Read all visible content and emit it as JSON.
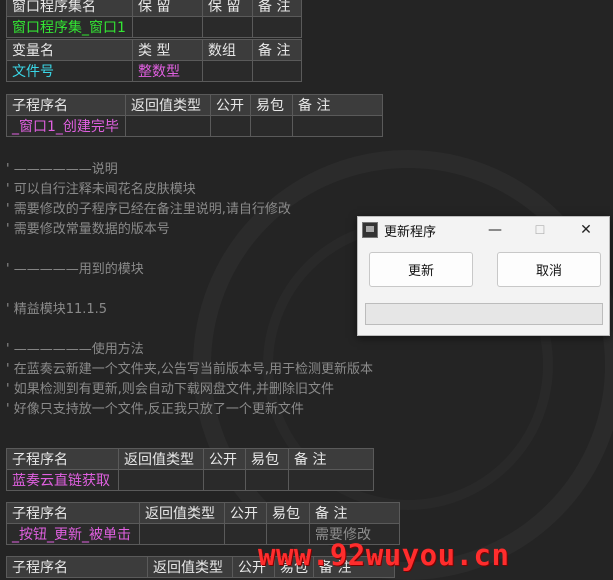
{
  "window_table": {
    "headers": [
      "窗口程序集名",
      "保 留",
      "保 留",
      "备 注"
    ],
    "row": [
      "窗口程序集_窗口1",
      "",
      "",
      ""
    ]
  },
  "variable_table": {
    "headers": [
      "变量名",
      "类 型",
      "数组",
      "备 注"
    ],
    "row": [
      "文件号",
      "整数型",
      "",
      ""
    ]
  },
  "sub1": {
    "headers": [
      "子程序名",
      "返回值类型",
      "公开",
      "易包",
      "备 注"
    ],
    "row": [
      "_窗口1_创建完毕",
      "",
      "",
      "",
      ""
    ]
  },
  "comments": [
    "' ——————说明",
    "' 可以自行注释未闻花名皮肤模块",
    "' 需要修改的子程序已经在备注里说明,请自行修改",
    "' 需要修改常量数据的版本号",
    "",
    "' —————用到的模块",
    "",
    "' 精益模块11.1.5",
    "",
    "' ——————使用方法",
    "' 在蓝奏云新建一个文件夹,公告写当前版本号,用于检测更新版本",
    "' 如果检测到有更新,则会自动下载网盘文件,并删除旧文件",
    "' 好像只支持放一个文件,反正我只放了一个更新文件"
  ],
  "sub2": {
    "headers": [
      "子程序名",
      "返回值类型",
      "公开",
      "易包",
      "备 注"
    ],
    "row": [
      "蓝奏云直链获取",
      "",
      "",
      "",
      ""
    ]
  },
  "sub3": {
    "headers": [
      "子程序名",
      "返回值类型",
      "公开",
      "易包",
      "备 注"
    ],
    "row": [
      "_按钮_更新_被单击",
      "",
      "",
      "",
      "需要修改"
    ]
  },
  "sub4": {
    "headers": [
      "子程序名",
      "返回值类型",
      "公开",
      "易包",
      "备 注"
    ]
  },
  "dialog": {
    "title": "更新程序",
    "minimize": "—",
    "maximize": "☐",
    "close": "✕",
    "update_button": "更新",
    "cancel_button": "取消",
    "progress": 0
  },
  "watermark": "www.92wuyou.cn",
  "colors": {
    "background": "#242424",
    "green": "#33e633",
    "cyan": "#3ad6e6",
    "magenta": "#e060e0",
    "yellow": "#e8d84a",
    "watermark": "#ff2d2d"
  }
}
